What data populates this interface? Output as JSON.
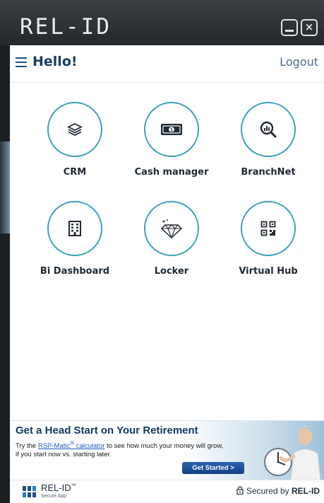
{
  "window": {
    "brand": "REL-ID",
    "minimize_label": "",
    "close_label": "×"
  },
  "header": {
    "greeting": "Hello!",
    "logout": "Logout"
  },
  "apps": [
    {
      "label": "CRM",
      "icon": "layers-icon"
    },
    {
      "label": "Cash manager",
      "icon": "banknote-icon"
    },
    {
      "label": "BranchNet",
      "icon": "search-chart-icon"
    },
    {
      "label": "Bi Dashboard",
      "icon": "building-icon"
    },
    {
      "label": "Locker",
      "icon": "diamond-icon"
    },
    {
      "label": "Virtual Hub",
      "icon": "qr-code-icon"
    }
  ],
  "banner": {
    "title": "Get a Head Start on Your Retirement",
    "text_before": "Try the ",
    "link": "RSP-Matic",
    "link_sup": "®",
    "link_after": " calculator",
    "text_after": " to see how much your money will grow, if you start now vs. starting later.",
    "button": "Get Started >"
  },
  "footer": {
    "brand": "REL-ID",
    "brand_tm": "™",
    "sub": "Secure App",
    "secured_prefix": "Secured by ",
    "secured_brand": "REL-ID"
  },
  "colors": {
    "accent": "#3aa3b9",
    "header_text": "#183d5f",
    "banner_title": "#123a66"
  }
}
